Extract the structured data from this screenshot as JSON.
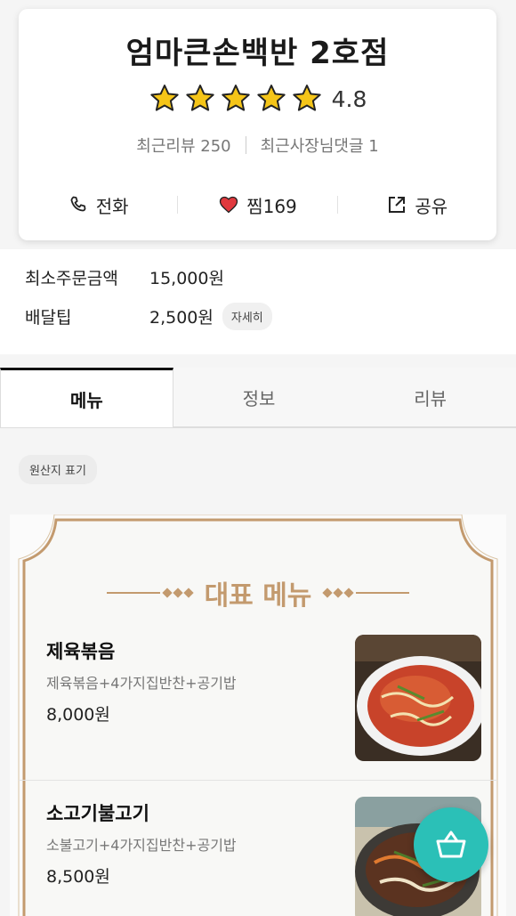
{
  "store": {
    "name": "엄마큰손백반 2호점",
    "rating": "4.8",
    "stars_filled": 5,
    "recent_reviews": "최근리뷰 250",
    "recent_owner_comments": "최근사장님댓글 1"
  },
  "actions": {
    "call": "전화",
    "like": "찜169",
    "share": "공유"
  },
  "info": {
    "min_order_label": "최소주문금액",
    "min_order_value": "15,000원",
    "delivery_tip_label": "배달팁",
    "delivery_tip_value": "2,500원",
    "detail_button": "자세히"
  },
  "tabs": [
    {
      "label": "메뉴",
      "active": true
    },
    {
      "label": "정보",
      "active": false
    },
    {
      "label": "리뷰",
      "active": false
    }
  ],
  "origin_button": "원산지 표기",
  "board": {
    "title": "대표 메뉴",
    "accent_color": "#c39a6e"
  },
  "menu": [
    {
      "name": "제육볶음",
      "desc": "제육볶음+4가지집반찬+공기밥",
      "price": "8,000원"
    },
    {
      "name": "소고기불고기",
      "desc": "소불고기+4가지집반찬+공기밥",
      "price": "8,500원"
    }
  ],
  "colors": {
    "star": "#f5c518",
    "heart": "#e0393e",
    "fab": "#2bc0b7"
  }
}
